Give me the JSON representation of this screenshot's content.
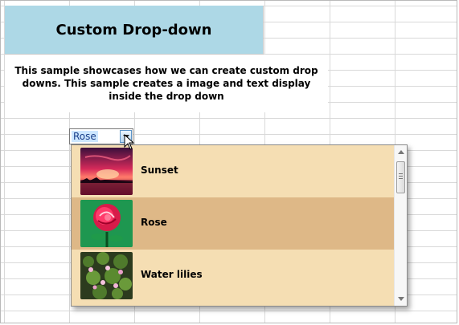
{
  "header": {
    "title": "Custom Drop-down"
  },
  "description": {
    "text": "This sample showcases how we can create custom drop downs. This sample creates a image and text display inside the drop down"
  },
  "combo": {
    "selected_value": "Rose"
  },
  "dropdown": {
    "items": [
      {
        "label": "Sunset",
        "image": "sunset-image",
        "selected": false
      },
      {
        "label": "Rose",
        "image": "rose-image",
        "selected": true
      },
      {
        "label": "Water lilies",
        "image": "water-lilies-image",
        "selected": false
      }
    ]
  },
  "colors": {
    "header_bg": "#add8e6",
    "list_bg": "#f5deb3",
    "selected_bg": "#deb887"
  }
}
